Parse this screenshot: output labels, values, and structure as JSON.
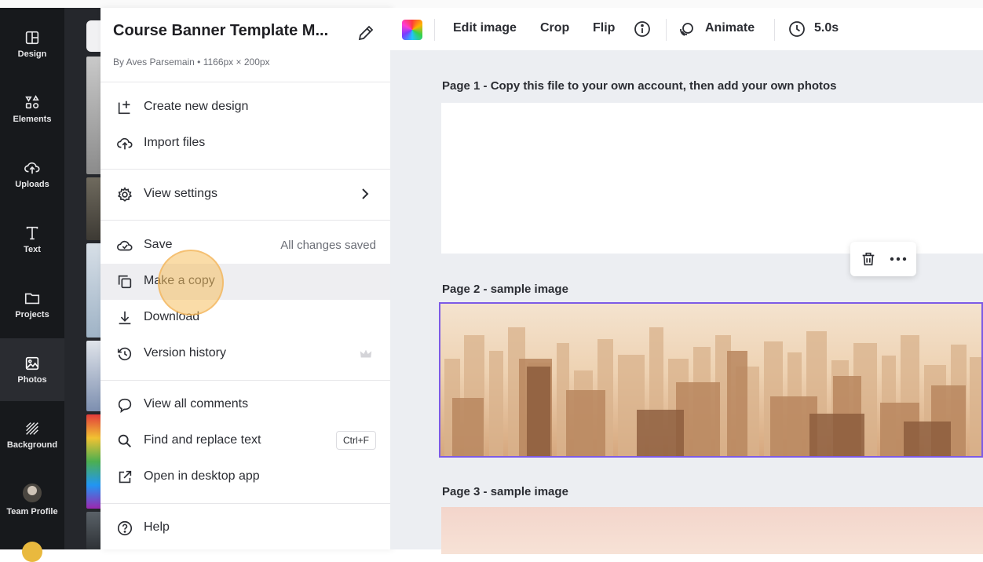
{
  "rail": {
    "items": [
      {
        "label": "Design",
        "icon": "design-icon"
      },
      {
        "label": "Elements",
        "icon": "elements-icon"
      },
      {
        "label": "Uploads",
        "icon": "cloud-upload-icon"
      },
      {
        "label": "Text",
        "icon": "text-icon"
      },
      {
        "label": "Projects",
        "icon": "folder-icon"
      },
      {
        "label": "Photos",
        "icon": "photo-icon",
        "active": true
      },
      {
        "label": "Background",
        "icon": "background-icon"
      },
      {
        "label": "Team Profile",
        "icon": "avatar"
      }
    ]
  },
  "menu": {
    "title": "Course Banner Template M...",
    "subtitle": "By Aves Parsemain • 1166px × 200px",
    "items": [
      {
        "label": "Create new design",
        "icon": "add-page-icon"
      },
      {
        "label": "Import files",
        "icon": "cloud-upload-icon"
      },
      {
        "label": "View settings",
        "icon": "gear-icon"
      },
      {
        "label": "Save",
        "icon": "cloud-check-icon",
        "status": "All changes saved"
      },
      {
        "label": "Make a copy",
        "icon": "copy-icon"
      },
      {
        "label": "Download",
        "icon": "download-icon"
      },
      {
        "label": "Version history",
        "icon": "history-icon"
      },
      {
        "label": "View all comments",
        "icon": "comment-icon"
      },
      {
        "label": "Find and replace text",
        "icon": "search-icon",
        "shortcut": "Ctrl+F"
      },
      {
        "label": "Open in desktop app",
        "icon": "external-link-icon"
      },
      {
        "label": "Help",
        "icon": "help-icon"
      }
    ]
  },
  "toolbar": {
    "edit_image": "Edit image",
    "crop": "Crop",
    "flip": "Flip",
    "animate": "Animate",
    "duration": "5.0s"
  },
  "canvas": {
    "page1_label": "Page 1 - Copy this file to your own account, then add your own photos",
    "page2_label": "Page 2 - sample image",
    "page3_label": "Page 3 - sample image"
  },
  "colors": {
    "rail_bg": "#17191c",
    "selection": "#7d5be6",
    "click_highlight": "#f6bf60"
  }
}
